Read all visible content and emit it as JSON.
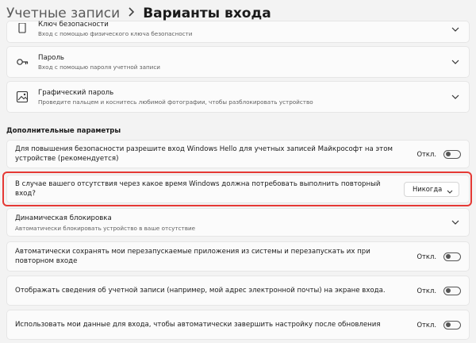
{
  "breadcrumb": {
    "parent": "Учетные записи",
    "current": "Варианты входа"
  },
  "methods": [
    {
      "title": "Ключ безопасности",
      "subtitle": "Вход с помощью физического ключа безопасности",
      "icon": "key-icon"
    },
    {
      "title": "Пароль",
      "subtitle": "Вход с помощью пароля учетной записи",
      "icon": "key-icon"
    },
    {
      "title": "Графический пароль",
      "subtitle": "Проведите пальцем и коснитесь любимой фотографии, чтобы разблокировать устройство",
      "icon": "picture-icon"
    }
  ],
  "additional": {
    "section_title": "Дополнительные параметры",
    "hello_only": {
      "text": "Для повышения безопасности разрешите вход Windows Hello для учетных записей Майкрософт на этом устройстве (рекомендуется)",
      "state": "Откл."
    },
    "require_signin": {
      "text": "В случае вашего отсутствия через какое время Windows должна потребовать выполнить повторный вход?",
      "selected": "Никогда"
    },
    "dynamic_lock": {
      "title": "Динамическая блокировка",
      "subtitle": "Автоматически блокировать устройство в ваше отсутствие"
    },
    "restart_apps": {
      "text": "Автоматически сохранять мои перезапускаемые приложения из системы и перезапускать их при повторном входе",
      "state": "Откл."
    },
    "show_account": {
      "text": "Отображать сведения об учетной записи (например, мой адрес электронной почты) на экране входа.",
      "state": "Откл."
    },
    "use_signin_info": {
      "text": "Использовать мои данные для входа, чтобы автоматически завершить настройку после обновления",
      "state": "Откл."
    }
  },
  "colors": {
    "highlight": "#e53935",
    "background": "#f3f3f3",
    "card": "#fbfbfb"
  }
}
